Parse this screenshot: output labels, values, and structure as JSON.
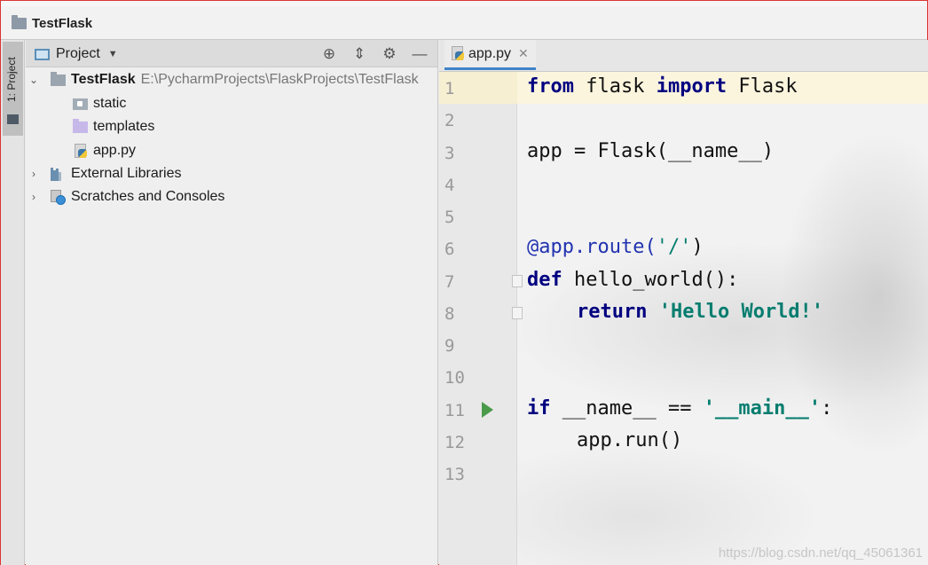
{
  "window": {
    "project_title": "TestFlask"
  },
  "tool_stripe": {
    "project_tab_label": "1: Project"
  },
  "project_panel": {
    "view_selector": "Project",
    "tree": [
      {
        "label": "TestFlask",
        "path": "E:\\PycharmProjects\\FlaskProjects\\TestFlask",
        "icon": "folder-icon",
        "expanded": true
      },
      {
        "label": "static",
        "icon": "resource-folder-icon"
      },
      {
        "label": "templates",
        "icon": "templates-folder-icon"
      },
      {
        "label": "app.py",
        "icon": "python-file-icon"
      },
      {
        "label": "External Libraries",
        "icon": "library-icon",
        "expanded": false
      },
      {
        "label": "Scratches and Consoles",
        "icon": "scratches-icon",
        "expanded": false
      }
    ]
  },
  "editor": {
    "tab_label": "app.py",
    "line_numbers": [
      "1",
      "2",
      "3",
      "4",
      "5",
      "6",
      "7",
      "8",
      "9",
      "10",
      "11",
      "12",
      "13"
    ],
    "lines": {
      "l1_kw1": "from",
      "l1_mid": " flask ",
      "l1_kw2": "import",
      "l1_end": " Flask",
      "l3": "app = Flask(__name__)",
      "l6_dec": "@app.route(",
      "l6_str": "'/'",
      "l6_end": ")",
      "l7_kw": "def",
      "l7_end": " hello_world():",
      "l8_kw": "return",
      "l8_str": "'Hello World!'",
      "l11_kw": "if",
      "l11_mid": " __name__ == ",
      "l11_str": "'__main__'",
      "l11_end": ":",
      "l12": "app.run()"
    }
  },
  "watermark": "https://blog.csdn.net/qq_45061361"
}
